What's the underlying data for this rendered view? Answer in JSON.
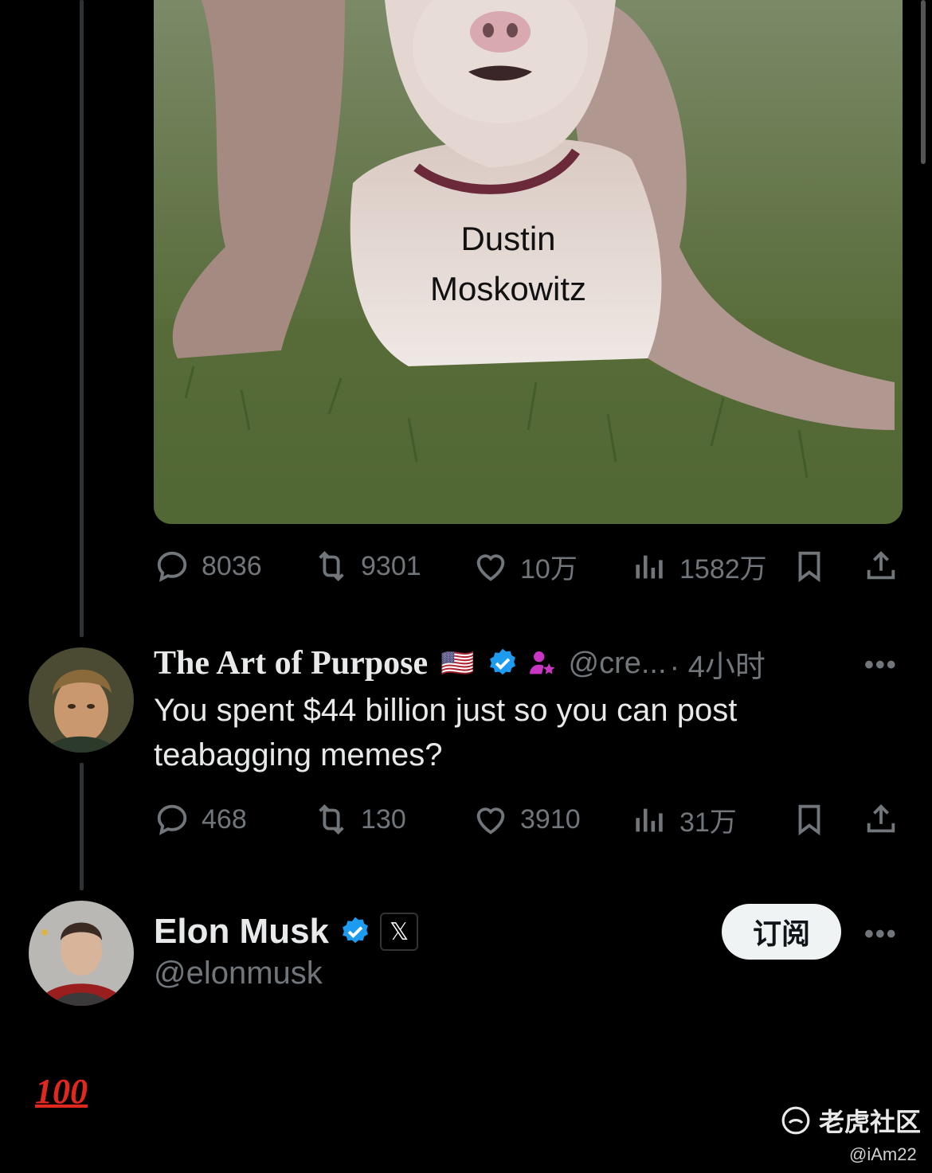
{
  "tweet1": {
    "media_caption_line1": "Dustin",
    "media_caption_line2": "Moskowitz",
    "actions": {
      "replies": "8036",
      "retweets": "9301",
      "likes": "10万",
      "views": "1582万"
    }
  },
  "tweet2": {
    "name": "The Art of Purpose",
    "flag": "🇺🇸",
    "handle": "@cre...",
    "time": "· 4小时",
    "text": "You spent $44 billion just so you can post teabagging memes?",
    "actions": {
      "replies": "468",
      "retweets": "130",
      "likes": "3910",
      "views": "31万"
    },
    "more_label": "•••"
  },
  "tweet3": {
    "name": "Elon Musk",
    "handle": "@elonmusk",
    "subscribe_label": "订阅",
    "more_label": "•••",
    "affiliate_badge": "𝕏",
    "body_emoji": "100"
  },
  "watermark": {
    "brand": "老虎社区",
    "user": "@iAm22"
  },
  "colors": {
    "background": "#000000",
    "text_primary": "#e7e9ea",
    "text_secondary": "#71767b",
    "verified_blue": "#1d9bf0",
    "subscribe_bg": "#eff3f4"
  }
}
